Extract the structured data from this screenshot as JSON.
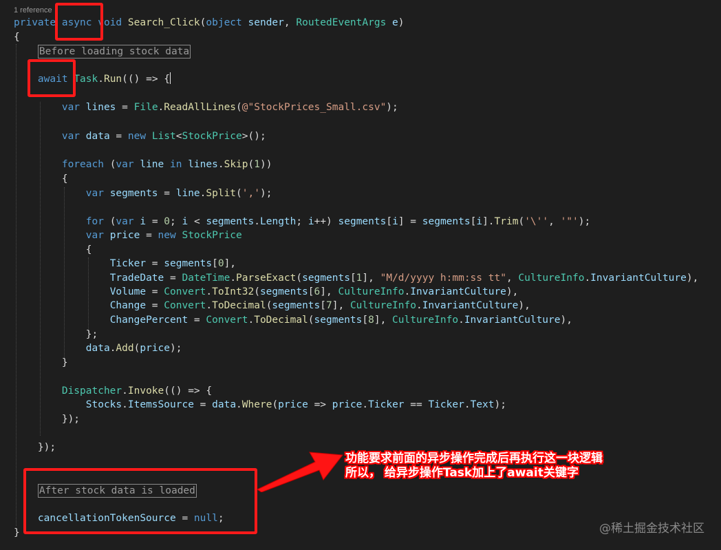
{
  "editor": {
    "codelens": "1 reference",
    "lines": [
      [
        [
          "kw",
          "private "
        ],
        [
          "kw",
          "async "
        ],
        [
          "kw",
          "void "
        ],
        [
          "fn",
          "Search_Click"
        ],
        [
          "pl",
          "("
        ],
        [
          "kw",
          "object "
        ],
        [
          "va",
          "sender"
        ],
        [
          "pl",
          ", "
        ],
        [
          "ty",
          "RoutedEventArgs "
        ],
        [
          "va",
          "e"
        ],
        [
          "pl",
          ")"
        ]
      ],
      [
        [
          "pl",
          "{"
        ]
      ],
      [
        [
          "pl",
          "    "
        ],
        [
          "cm",
          "Before loading stock data"
        ]
      ],
      [
        [
          "pl",
          "    "
        ],
        [
          "kw",
          "await "
        ],
        [
          "ty",
          "Task"
        ],
        [
          "pl",
          "."
        ],
        [
          "fn",
          "Run"
        ],
        [
          "pl",
          "(() => {"
        ]
      ],
      [
        [
          "pl",
          "        "
        ],
        [
          "kw",
          "var "
        ],
        [
          "va",
          "lines "
        ],
        [
          "pl",
          "= "
        ],
        [
          "ty",
          "File"
        ],
        [
          "pl",
          "."
        ],
        [
          "fn",
          "ReadAllLines"
        ],
        [
          "pl",
          "("
        ],
        [
          "st",
          "@\"StockPrices_Small.csv\""
        ],
        [
          "pl",
          ");"
        ]
      ],
      [
        [
          "pl",
          "        "
        ],
        [
          "kw",
          "var "
        ],
        [
          "va",
          "data "
        ],
        [
          "pl",
          "= "
        ],
        [
          "kw",
          "new "
        ],
        [
          "ty",
          "List"
        ],
        [
          "pl",
          "<"
        ],
        [
          "ty",
          "StockPrice"
        ],
        [
          "pl",
          ">();"
        ]
      ],
      [
        [
          "pl",
          "        "
        ],
        [
          "kw",
          "foreach "
        ],
        [
          "pl",
          "("
        ],
        [
          "kw",
          "var "
        ],
        [
          "va",
          "line "
        ],
        [
          "kw",
          "in "
        ],
        [
          "va",
          "lines"
        ],
        [
          "pl",
          "."
        ],
        [
          "fn",
          "Skip"
        ],
        [
          "pl",
          "("
        ],
        [
          "nu",
          "1"
        ],
        [
          "pl",
          "))"
        ]
      ],
      [
        [
          "pl",
          "        {"
        ]
      ],
      [
        [
          "pl",
          "            "
        ],
        [
          "kw",
          "var "
        ],
        [
          "va",
          "segments "
        ],
        [
          "pl",
          "= "
        ],
        [
          "va",
          "line"
        ],
        [
          "pl",
          "."
        ],
        [
          "fn",
          "Split"
        ],
        [
          "pl",
          "("
        ],
        [
          "st",
          "','"
        ],
        [
          "pl",
          ");"
        ]
      ],
      [
        [
          "pl",
          "            "
        ],
        [
          "kw",
          "for "
        ],
        [
          "pl",
          "("
        ],
        [
          "kw",
          "var "
        ],
        [
          "va",
          "i "
        ],
        [
          "pl",
          "= "
        ],
        [
          "nu",
          "0"
        ],
        [
          "pl",
          "; "
        ],
        [
          "va",
          "i "
        ],
        [
          "pl",
          "< "
        ],
        [
          "va",
          "segments"
        ],
        [
          "pl",
          "."
        ],
        [
          "va",
          "Length"
        ],
        [
          "pl",
          "; "
        ],
        [
          "va",
          "i"
        ],
        [
          "pl",
          "++) "
        ],
        [
          "va",
          "segments"
        ],
        [
          "pl",
          "["
        ],
        [
          "va",
          "i"
        ],
        [
          "pl",
          "] = "
        ],
        [
          "va",
          "segments"
        ],
        [
          "pl",
          "["
        ],
        [
          "va",
          "i"
        ],
        [
          "pl",
          "]."
        ],
        [
          "fn",
          "Trim"
        ],
        [
          "pl",
          "("
        ],
        [
          "st",
          "'\\''"
        ],
        [
          "pl",
          ", "
        ],
        [
          "st",
          "'\"'"
        ],
        [
          "pl",
          ");"
        ]
      ],
      [
        [
          "pl",
          "            "
        ],
        [
          "kw",
          "var "
        ],
        [
          "va",
          "price "
        ],
        [
          "pl",
          "= "
        ],
        [
          "kw",
          "new "
        ],
        [
          "ty",
          "StockPrice"
        ]
      ],
      [
        [
          "pl",
          "            {"
        ]
      ],
      [
        [
          "pl",
          "                "
        ],
        [
          "va",
          "Ticker "
        ],
        [
          "pl",
          "= "
        ],
        [
          "va",
          "segments"
        ],
        [
          "pl",
          "["
        ],
        [
          "nu",
          "0"
        ],
        [
          "pl",
          "],"
        ]
      ],
      [
        [
          "pl",
          "                "
        ],
        [
          "va",
          "TradeDate "
        ],
        [
          "pl",
          "= "
        ],
        [
          "ty",
          "DateTime"
        ],
        [
          "pl",
          "."
        ],
        [
          "fn",
          "ParseExact"
        ],
        [
          "pl",
          "("
        ],
        [
          "va",
          "segments"
        ],
        [
          "pl",
          "["
        ],
        [
          "nu",
          "1"
        ],
        [
          "pl",
          "], "
        ],
        [
          "st",
          "\"M/d/yyyy h:mm:ss tt\""
        ],
        [
          "pl",
          ", "
        ],
        [
          "ty",
          "CultureInfo"
        ],
        [
          "pl",
          "."
        ],
        [
          "va",
          "InvariantCulture"
        ],
        [
          "pl",
          "),"
        ]
      ],
      [
        [
          "pl",
          "                "
        ],
        [
          "va",
          "Volume "
        ],
        [
          "pl",
          "= "
        ],
        [
          "ty",
          "Convert"
        ],
        [
          "pl",
          "."
        ],
        [
          "fn",
          "ToInt32"
        ],
        [
          "pl",
          "("
        ],
        [
          "va",
          "segments"
        ],
        [
          "pl",
          "["
        ],
        [
          "nu",
          "6"
        ],
        [
          "pl",
          "], "
        ],
        [
          "ty",
          "CultureInfo"
        ],
        [
          "pl",
          "."
        ],
        [
          "va",
          "InvariantCulture"
        ],
        [
          "pl",
          "),"
        ]
      ],
      [
        [
          "pl",
          "                "
        ],
        [
          "va",
          "Change "
        ],
        [
          "pl",
          "= "
        ],
        [
          "ty",
          "Convert"
        ],
        [
          "pl",
          "."
        ],
        [
          "fn",
          "ToDecimal"
        ],
        [
          "pl",
          "("
        ],
        [
          "va",
          "segments"
        ],
        [
          "pl",
          "["
        ],
        [
          "nu",
          "7"
        ],
        [
          "pl",
          "], "
        ],
        [
          "ty",
          "CultureInfo"
        ],
        [
          "pl",
          "."
        ],
        [
          "va",
          "InvariantCulture"
        ],
        [
          "pl",
          "),"
        ]
      ],
      [
        [
          "pl",
          "                "
        ],
        [
          "va",
          "ChangePercent "
        ],
        [
          "pl",
          "= "
        ],
        [
          "ty",
          "Convert"
        ],
        [
          "pl",
          "."
        ],
        [
          "fn",
          "ToDecimal"
        ],
        [
          "pl",
          "("
        ],
        [
          "va",
          "segments"
        ],
        [
          "pl",
          "["
        ],
        [
          "nu",
          "8"
        ],
        [
          "pl",
          "], "
        ],
        [
          "ty",
          "CultureInfo"
        ],
        [
          "pl",
          "."
        ],
        [
          "va",
          "InvariantCulture"
        ],
        [
          "pl",
          "),"
        ]
      ],
      [
        [
          "pl",
          "            };"
        ]
      ],
      [
        [
          "pl",
          "            "
        ],
        [
          "va",
          "data"
        ],
        [
          "pl",
          "."
        ],
        [
          "fn",
          "Add"
        ],
        [
          "pl",
          "("
        ],
        [
          "va",
          "price"
        ],
        [
          "pl",
          ");"
        ]
      ],
      [
        [
          "pl",
          "        }"
        ]
      ],
      [
        [
          "pl",
          "        "
        ],
        [
          "ty",
          "Dispatcher"
        ],
        [
          "pl",
          "."
        ],
        [
          "fn",
          "Invoke"
        ],
        [
          "pl",
          "(() => {"
        ]
      ],
      [
        [
          "pl",
          "            "
        ],
        [
          "va",
          "Stocks"
        ],
        [
          "pl",
          "."
        ],
        [
          "va",
          "ItemsSource "
        ],
        [
          "pl",
          "= "
        ],
        [
          "va",
          "data"
        ],
        [
          "pl",
          "."
        ],
        [
          "fn",
          "Where"
        ],
        [
          "pl",
          "("
        ],
        [
          "va",
          "price "
        ],
        [
          "pl",
          "=> "
        ],
        [
          "va",
          "price"
        ],
        [
          "pl",
          "."
        ],
        [
          "va",
          "Ticker "
        ],
        [
          "pl",
          "== "
        ],
        [
          "va",
          "Ticker"
        ],
        [
          "pl",
          "."
        ],
        [
          "va",
          "Text"
        ],
        [
          "pl",
          ");"
        ]
      ],
      [
        [
          "pl",
          "        });"
        ]
      ],
      [
        [
          "pl",
          "    });"
        ]
      ],
      [
        [
          "pl",
          "    "
        ],
        [
          "cm",
          "After stock data is loaded"
        ]
      ],
      [
        [
          "pl",
          "    "
        ],
        [
          "va",
          "cancellationTokenSource "
        ],
        [
          "pl",
          "= "
        ],
        [
          "kw",
          "null"
        ],
        [
          "pl",
          ";"
        ]
      ],
      [
        [
          "pl",
          "}"
        ]
      ]
    ]
  },
  "annotation": {
    "line1": "功能要求前面的异步操作完成后再执行这一块逻辑",
    "line2": "所以，  给异步操作Task加上了await关键字"
  },
  "watermark": "@稀土掘金技术社区"
}
